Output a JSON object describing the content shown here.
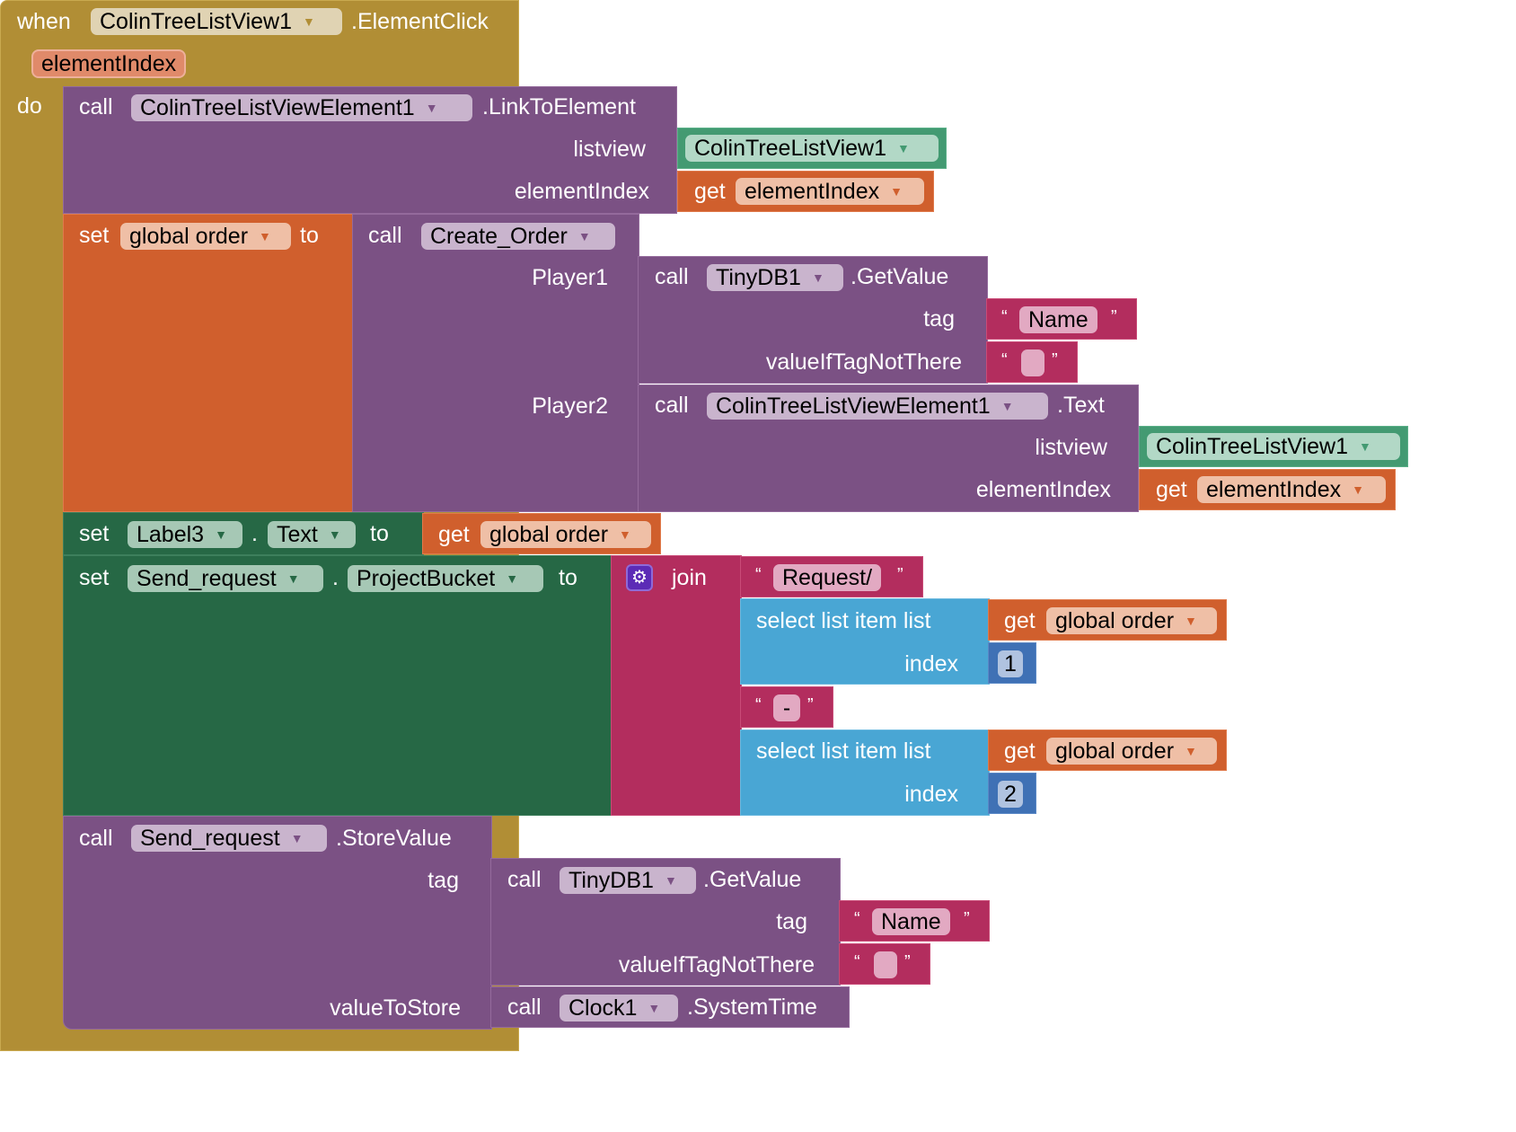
{
  "event": {
    "when_label": "when",
    "component": "ColinTreeListView1",
    "event_name": ".ElementClick",
    "param": "elementIndex",
    "do_label": "do"
  },
  "link_call": {
    "call_label": "call",
    "component": "ColinTreeListViewElement1",
    "method": ".LinkToElement",
    "arg1_label": "listview",
    "arg1_component": "ColinTreeListView1",
    "arg2_label": "elementIndex",
    "arg2_get": "get",
    "arg2_var": "elementIndex"
  },
  "set_order": {
    "set_label": "set",
    "var": "global order",
    "to_label": "to",
    "call_label": "call",
    "procedure": "Create_Order",
    "player1_label": "Player1",
    "p1_call": "call",
    "p1_component": "TinyDB1",
    "p1_method": ".GetValue",
    "p1_tag_label": "tag",
    "p1_tag_value": "Name",
    "p1_default_label": "valueIfTagNotThere",
    "p1_default_value": "",
    "player2_label": "Player2",
    "p2_call": "call",
    "p2_component": "ColinTreeListViewElement1",
    "p2_method": ".Text",
    "p2_listview_label": "listview",
    "p2_listview_component": "ColinTreeListView1",
    "p2_index_label": "elementIndex",
    "p2_get": "get",
    "p2_var": "elementIndex"
  },
  "set_label3": {
    "set_label": "set",
    "component": "Label3",
    "dot": ".",
    "property": "Text",
    "to_label": "to",
    "get": "get",
    "var": "global order"
  },
  "set_bucket": {
    "set_label": "set",
    "component": "Send_request",
    "dot": ".",
    "property": "ProjectBucket",
    "to_label": "to",
    "join_label": "join",
    "str1": "Request/",
    "sel1_label": "select list item  list",
    "sel1_get": "get",
    "sel1_var": "global order",
    "sel1_index_label": "index",
    "sel1_index": "1",
    "str2": "-",
    "sel2_label": "select list item  list",
    "sel2_get": "get",
    "sel2_var": "global order",
    "sel2_index_label": "index",
    "sel2_index": "2"
  },
  "store_call": {
    "call_label": "call",
    "component": "Send_request",
    "method": ".StoreValue",
    "tag_label": "tag",
    "tag_call": "call",
    "tag_component": "TinyDB1",
    "tag_method": ".GetValue",
    "inner_tag_label": "tag",
    "inner_tag_value": "Name",
    "inner_default_label": "valueIfTagNotThere",
    "inner_default_value": "",
    "value_label": "valueToStore",
    "value_call": "call",
    "value_component": "Clock1",
    "value_method": ".SystemTime"
  },
  "quotes": {
    "open": "“",
    "close": "”"
  },
  "arrow": "▼",
  "gear_glyph": "⚙"
}
